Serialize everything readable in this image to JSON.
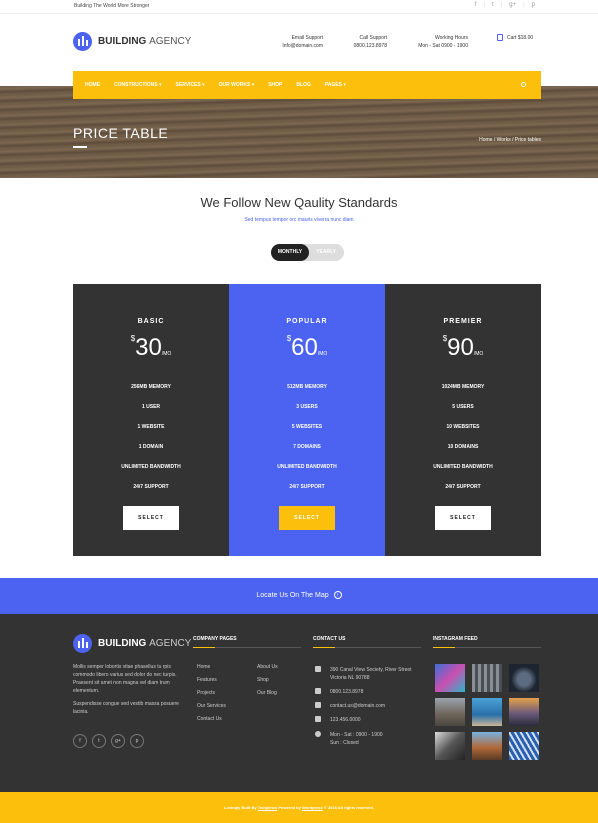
{
  "topbar": {
    "tagline": "Building The World More Stronger",
    "social": [
      "f",
      "t",
      "g+",
      "p"
    ]
  },
  "header": {
    "logo_bold": "BUILDING",
    "logo_light": "AGENCY",
    "email_label": "Email Support",
    "email_value": "Info@domain.com",
    "call_label": "Call Support",
    "call_value": "0800.123.8978",
    "hours_label": "Working Hours",
    "hours_value": "Mon - Sat 0900 - 1900",
    "cart_label": "Cart $18.00"
  },
  "nav": {
    "items": [
      "HOME",
      "CONSTRUCTIONS",
      "SERVICES",
      "OUR WORKS",
      "SHOP",
      "BLOG",
      "PAGES"
    ]
  },
  "hero": {
    "title": "PRICE TABLE",
    "breadcrumb": "Home  /  Works  /  Price tables"
  },
  "pricing": {
    "title": "We Follow New Qaulity Standards",
    "subtitle": "Sed tempus tempor orc mauris viverra nunc diam",
    "toggle_on": "MONTHLY",
    "toggle_off": "YEARLY",
    "plans": [
      {
        "name": "BASIC",
        "currency": "$",
        "amount": "30",
        "period": "/MO",
        "features": [
          "256MB MEMORY",
          "1 USER",
          "1 WEBSITE",
          "1 DOMAIN",
          "UNLIMITED BANDWIDTH",
          "24/7 SUPPORT"
        ],
        "button": "SELECT"
      },
      {
        "name": "POPULAR",
        "currency": "$",
        "amount": "60",
        "period": "/MO",
        "features": [
          "512MB MEMORY",
          "3 USERS",
          "5 WEBSITES",
          "7 DOMAINS",
          "UNLIMITED BANDWIDTH",
          "24/7 SUPPORT"
        ],
        "button": "SELECT"
      },
      {
        "name": "PREMIER",
        "currency": "$",
        "amount": "90",
        "period": "/MO",
        "features": [
          "1024MB MEMORY",
          "5 USERS",
          "10 WEBSITES",
          "10 DOMAINS",
          "UNLIMITED BANDWIDTH",
          "24/7 SUPPORT"
        ],
        "button": "SELECT"
      }
    ]
  },
  "locate": {
    "label": "Locate Us On The Map"
  },
  "footer": {
    "logo_bold": "BUILDING",
    "logo_light": "AGENCY",
    "about_p1": "Mollis semper lobortis vitae phasellus tu rpis commodo libero varius sed dolor do nec turpis. Praesent sit amet non magna vel diam trum elementum.",
    "about_p2": "Suspendisse congue sed vestib massa posuere lacinia.",
    "social": [
      "f",
      "t",
      "g+",
      "p"
    ],
    "company_heading": "COMPANY PAGES",
    "company_col1": [
      "Home",
      "Features",
      "Projects",
      "Our Services",
      "Contact Us"
    ],
    "company_col2": [
      "About Us",
      "Shop",
      "Our Blog"
    ],
    "contact_heading": "CONTACT US",
    "contact": {
      "address": "390 Canal View Society, River Street Victoria NL 90788",
      "phone": "0800.123.8978",
      "email": "contact.us@domain.com",
      "fax": "123.456.0000",
      "hours1": "Mon - Sat : 0900 - 1900",
      "hours2": "Sun : Closed"
    },
    "instagram_heading": "INSTAGRAM FEED"
  },
  "bottom": {
    "prefix": "Lovingly Built By",
    "link1": "Templines",
    "middle": "Powered by",
    "link2": "Wordpress",
    "suffix": "© 2016 All rights reserved."
  },
  "colors": {
    "accent_blue": "#4b63f0",
    "accent_yellow": "#fbbf0c",
    "dark": "#333333"
  }
}
